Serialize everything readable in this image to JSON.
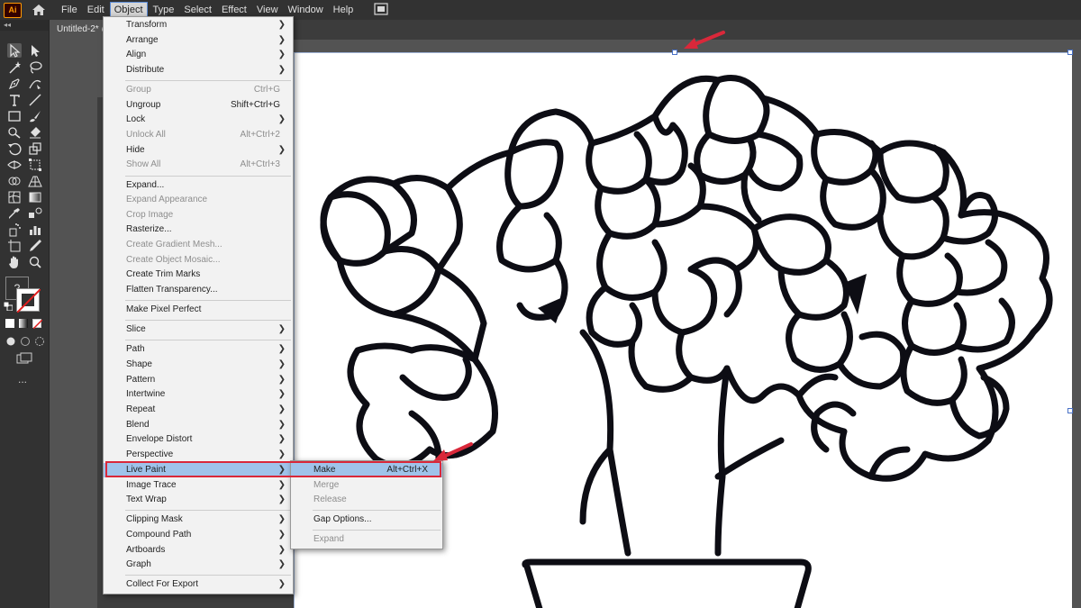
{
  "app": {
    "logo_text": "Ai"
  },
  "menubar": {
    "items": [
      "File",
      "Edit",
      "Object",
      "Type",
      "Select",
      "Effect",
      "View",
      "Window",
      "Help"
    ],
    "active": "Object"
  },
  "document": {
    "tab_title": "Untitled-2* @"
  },
  "panel": {
    "percent_label": "%"
  },
  "toolbar": {
    "header": "◂◂",
    "more_label": "..."
  },
  "object_menu": {
    "items": [
      {
        "label": "Transform",
        "submenu": true
      },
      {
        "label": "Arrange",
        "submenu": true
      },
      {
        "label": "Align",
        "submenu": true
      },
      {
        "label": "Distribute",
        "submenu": true
      },
      {
        "label": "Group",
        "shortcut": "Ctrl+G",
        "disabled": true
      },
      {
        "label": "Ungroup",
        "shortcut": "Shift+Ctrl+G"
      },
      {
        "label": "Lock",
        "submenu": true
      },
      {
        "label": "Unlock All",
        "shortcut": "Alt+Ctrl+2",
        "disabled": true
      },
      {
        "label": "Hide",
        "submenu": true
      },
      {
        "label": "Show All",
        "shortcut": "Alt+Ctrl+3",
        "disabled": true
      },
      {
        "label": "Expand..."
      },
      {
        "label": "Expand Appearance",
        "disabled": true
      },
      {
        "label": "Crop Image",
        "disabled": true
      },
      {
        "label": "Rasterize..."
      },
      {
        "label": "Create Gradient Mesh...",
        "disabled": true
      },
      {
        "label": "Create Object Mosaic...",
        "disabled": true
      },
      {
        "label": "Create Trim Marks"
      },
      {
        "label": "Flatten Transparency..."
      },
      {
        "label": "Make Pixel Perfect"
      },
      {
        "label": "Slice",
        "submenu": true
      },
      {
        "label": "Path",
        "submenu": true
      },
      {
        "label": "Shape",
        "submenu": true
      },
      {
        "label": "Pattern",
        "submenu": true
      },
      {
        "label": "Intertwine",
        "submenu": true
      },
      {
        "label": "Repeat",
        "submenu": true
      },
      {
        "label": "Blend",
        "submenu": true
      },
      {
        "label": "Envelope Distort",
        "submenu": true
      },
      {
        "label": "Perspective",
        "submenu": true
      },
      {
        "label": "Live Paint",
        "submenu": true,
        "highlighted": true
      },
      {
        "label": "Image Trace",
        "submenu": true
      },
      {
        "label": "Text Wrap",
        "submenu": true
      },
      {
        "label": "Clipping Mask",
        "submenu": true
      },
      {
        "label": "Compound Path",
        "submenu": true
      },
      {
        "label": "Artboards",
        "submenu": true
      },
      {
        "label": "Graph",
        "submenu": true
      },
      {
        "label": "Collect For Export",
        "submenu": true
      }
    ]
  },
  "live_paint_submenu": {
    "items": [
      {
        "label": "Make",
        "shortcut": "Alt+Ctrl+X",
        "highlighted": true
      },
      {
        "label": "Merge",
        "disabled": true
      },
      {
        "label": "Release",
        "disabled": true
      },
      {
        "label": "Gap Options..."
      },
      {
        "label": "Expand",
        "disabled": true
      }
    ]
  },
  "colors": {
    "accent_highlight": "#9fc3ea",
    "annotation_red": "#d9283a",
    "artboard_bg": "#ffffff"
  }
}
